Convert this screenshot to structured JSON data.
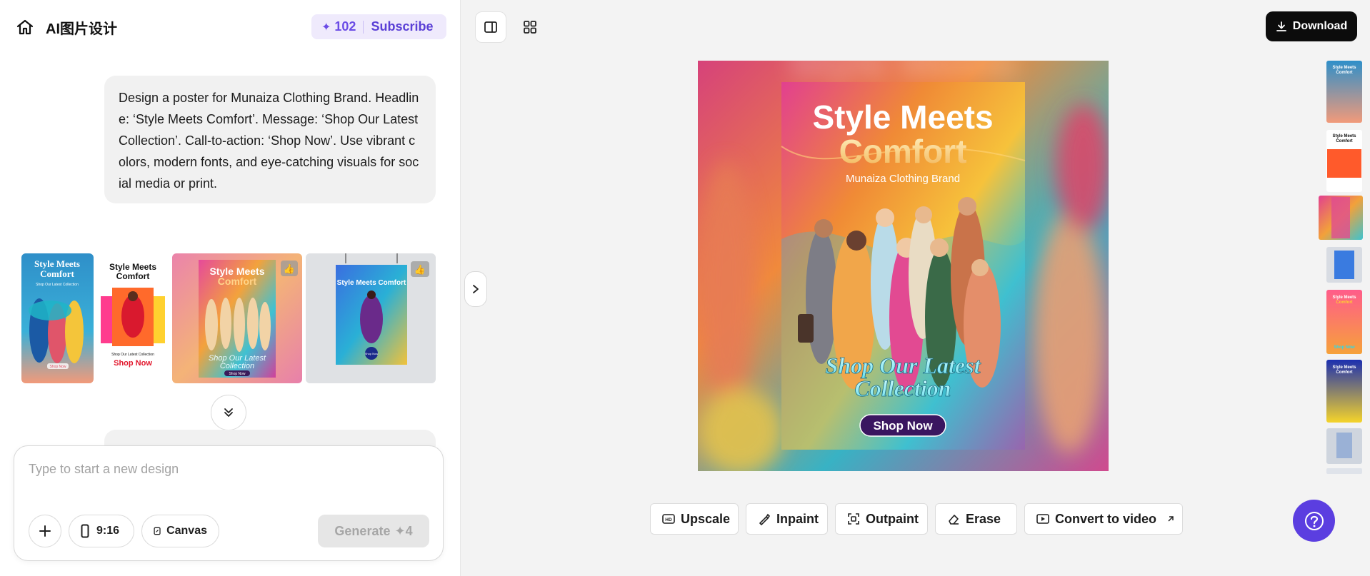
{
  "header": {
    "title": "AI图片设计",
    "credits": "102",
    "subscribe_label": "Subscribe",
    "home_icon": "home-icon"
  },
  "chat": {
    "prompt": "Design a poster for Munaiza Clothing Brand. Headline: ‘Style Meets Comfort’. Message: ‘Shop Our Latest Collection’. Call-to-action: ‘Shop Now’. Use vibrant colors, modern fonts, and eye-catching visuals for social media or print."
  },
  "thumbnails": [
    {
      "headline": "Style Meets Comfort",
      "sub": "Shop Our Latest Collection",
      "cta": "Shop Now"
    },
    {
      "headline": "Style Meets Comfort",
      "sub": "Shop Our Latest Collection",
      "cta": "Shop Now"
    },
    {
      "headline": "Style Meets Comfort",
      "sub": "Shop Our Latest Collection",
      "cta": "Shop Now"
    },
    {
      "headline": "Style Meets Comfort",
      "cta": "Shop Now"
    }
  ],
  "composer": {
    "placeholder": "Type to start a new design",
    "ratio_label": "9:16",
    "canvas_label": "Canvas",
    "generate_label": "Generate",
    "generate_cost": "4"
  },
  "toolbar": {
    "download_label": "Download"
  },
  "poster": {
    "headline_line1": "Style Meets",
    "headline_line2": "Comfort",
    "brand": "Munaiza Clothing Brand",
    "message_line1": "Shop Our Latest",
    "message_line2": "Collection",
    "cta": "Shop Now",
    "bg_text": "Style Meets"
  },
  "actions": {
    "upscale": "Upscale",
    "inpaint": "Inpaint",
    "outpaint": "Outpaint",
    "erase": "Erase",
    "convert": "Convert to video"
  },
  "colors": {
    "accent": "#5b3ee0",
    "credit_text": "#6b4ce6",
    "download_bg": "#0c0c0c"
  }
}
